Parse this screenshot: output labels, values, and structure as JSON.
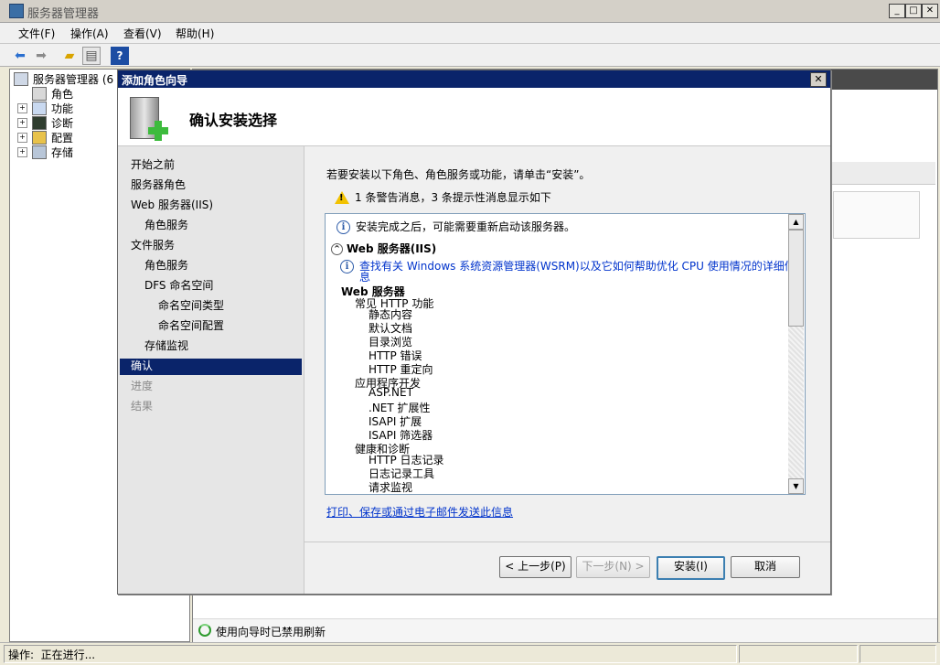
{
  "window": {
    "title": "服务器管理器",
    "minimize": "_",
    "maximize": "□",
    "close": "✕"
  },
  "menubar": [
    "文件(F)",
    "操作(A)",
    "查看(V)",
    "帮助(H)"
  ],
  "toolbar": {
    "icons": [
      "back-arrow-icon",
      "forward-arrow-icon",
      "up-folder-icon",
      "show-hide-tree-icon",
      "help-icon"
    ],
    "help_glyph": "?"
  },
  "tree": {
    "root": "服务器管理器 (6",
    "items": [
      {
        "label": "角色",
        "expander": ""
      },
      {
        "label": "功能",
        "expander": "+"
      },
      {
        "label": "诊断",
        "expander": "+"
      },
      {
        "label": "配置",
        "expander": "+"
      },
      {
        "label": "存储",
        "expander": "+"
      }
    ]
  },
  "right_pane": {
    "refresh_text": "使用向导时已禁用刷新"
  },
  "status": {
    "text": "操作:  正在进行..."
  },
  "dialog": {
    "title": "添加角色向导",
    "close": "✕",
    "heading": "确认安装选择",
    "nav": [
      {
        "label": "开始之前",
        "level": 0,
        "state": "normal"
      },
      {
        "label": "服务器角色",
        "level": 0,
        "state": "normal"
      },
      {
        "label": "Web 服务器(IIS)",
        "level": 0,
        "state": "normal"
      },
      {
        "label": "角色服务",
        "level": 1,
        "state": "normal"
      },
      {
        "label": "文件服务",
        "level": 0,
        "state": "normal"
      },
      {
        "label": "角色服务",
        "level": 1,
        "state": "normal"
      },
      {
        "label": "DFS 命名空间",
        "level": 1,
        "state": "normal"
      },
      {
        "label": "命名空间类型",
        "level": 2,
        "state": "normal"
      },
      {
        "label": "命名空间配置",
        "level": 2,
        "state": "normal"
      },
      {
        "label": "存储监视",
        "level": 1,
        "state": "normal"
      },
      {
        "label": "确认",
        "level": 0,
        "state": "selected"
      },
      {
        "label": "进度",
        "level": 0,
        "state": "disabled"
      },
      {
        "label": "结果",
        "level": 0,
        "state": "disabled"
      }
    ],
    "intro": "若要安装以下角色、角色服务或功能，请单击“安装”。",
    "warning_summary": "1 条警告消息，3 条提示性消息显示如下",
    "list": {
      "restart_info": "安装完成之后，可能需要重新启动该服务器。",
      "section_title": "Web 服务器(IIS)",
      "collapse_glyph": "^",
      "link_line1": "查找有关 Windows 系统资源管理器(WSRM)以及它如何帮助优化 CPU 使用情况的详细信",
      "link_line2": "息",
      "tree": [
        {
          "text": "Web 服务器",
          "level": 0
        },
        {
          "text": "常见 HTTP 功能",
          "level": 1
        },
        {
          "text": "静态内容",
          "level": 2
        },
        {
          "text": "默认文档",
          "level": 2
        },
        {
          "text": "目录浏览",
          "level": 2
        },
        {
          "text": "HTTP 错误",
          "level": 2
        },
        {
          "text": "HTTP 重定向",
          "level": 2
        },
        {
          "text": "应用程序开发",
          "level": 1
        },
        {
          "text": "ASP.NET",
          "level": 2
        },
        {
          "text": ".NET 扩展性",
          "level": 2
        },
        {
          "text": "ISAPI 扩展",
          "level": 2
        },
        {
          "text": "ISAPI 筛选器",
          "level": 2
        },
        {
          "text": "健康和诊断",
          "level": 1
        },
        {
          "text": "HTTP 日志记录",
          "level": 2
        },
        {
          "text": "日志记录工具",
          "level": 2
        },
        {
          "text": "请求监视",
          "level": 2
        }
      ]
    },
    "print_link": "打印、保存或通过电子邮件发送此信息",
    "buttons": {
      "prev": "< 上一步(P)",
      "next": "下一步(N) >",
      "install": "安装(I)",
      "cancel": "取消"
    },
    "scroll_up": "▲",
    "scroll_down": "▼"
  }
}
